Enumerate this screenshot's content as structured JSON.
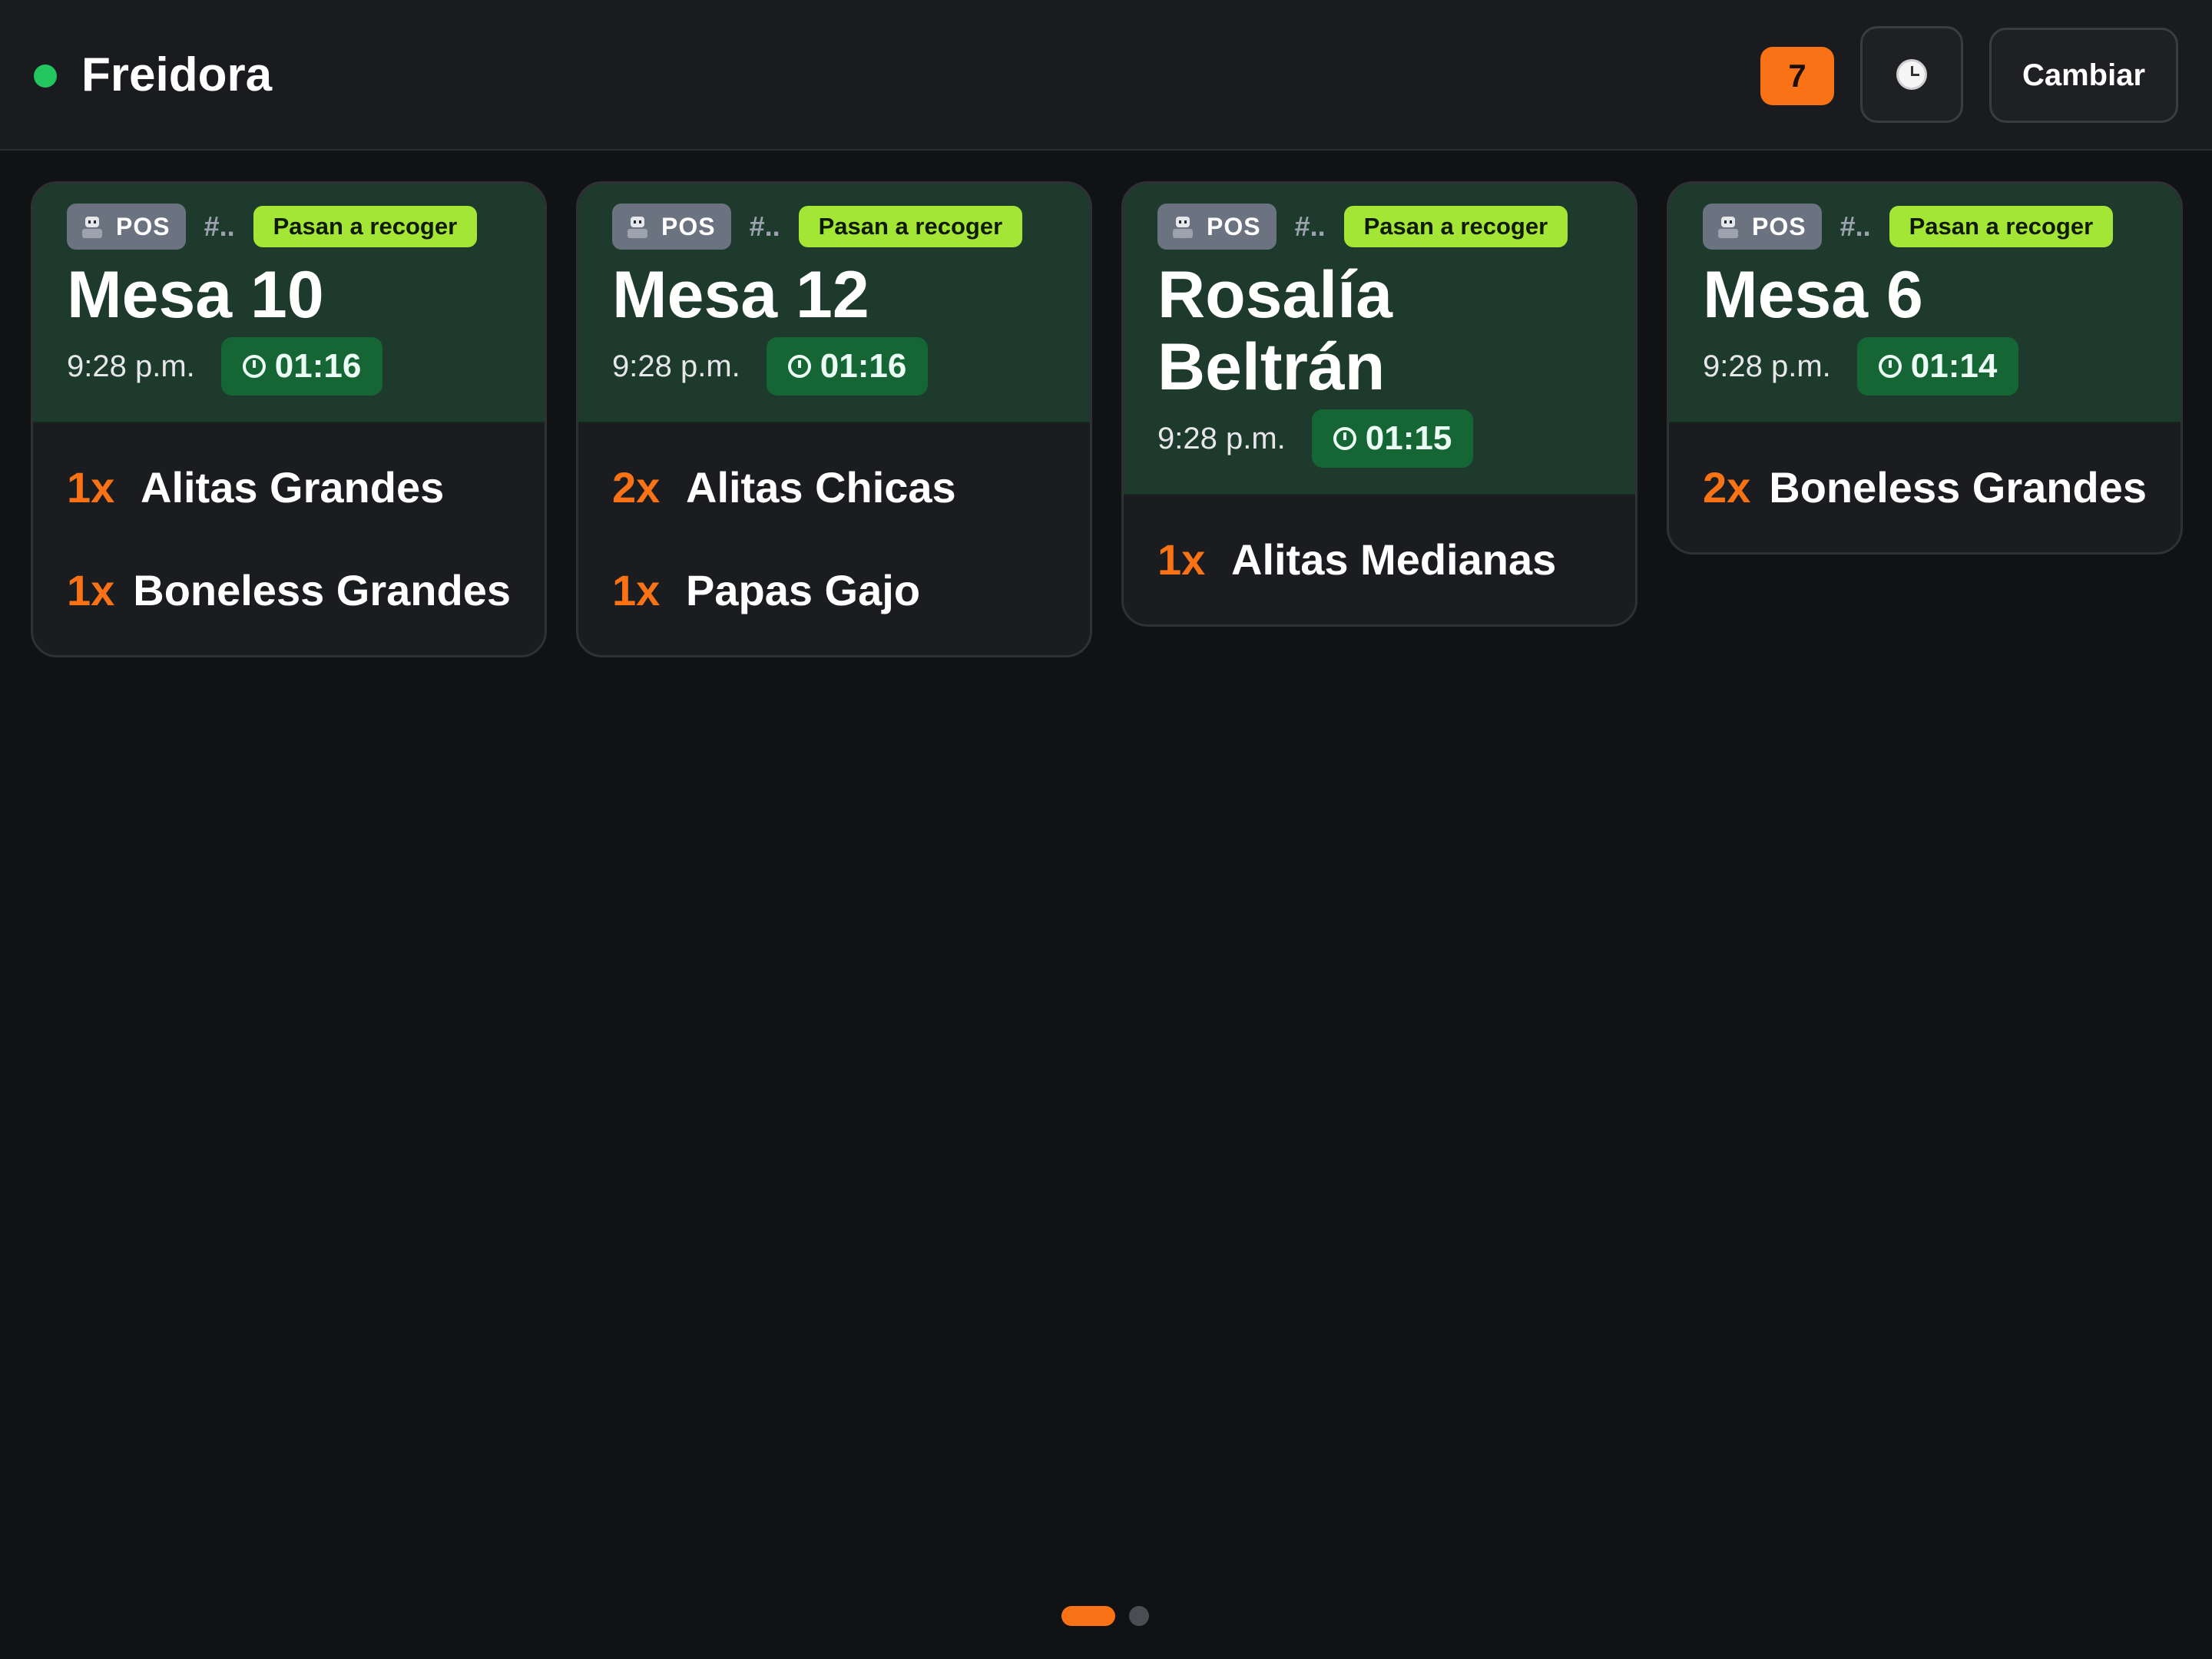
{
  "header": {
    "station_name": "Freidora",
    "status_color": "#22c55e",
    "pending_count": "7",
    "history_icon": "clock-icon",
    "change_station_label": "Cambiar"
  },
  "tickets": [
    {
      "source": "POS",
      "order_number": "#..",
      "status_tag": "Pasan a recoger",
      "title": "Mesa 10",
      "time": "9:28 p.m.",
      "elapsed": "01:16",
      "items": [
        {
          "qty": "1x",
          "name": "Alitas Grandes"
        },
        {
          "qty": "1x",
          "name": "Boneless Grandes"
        }
      ]
    },
    {
      "source": "POS",
      "order_number": "#..",
      "status_tag": "Pasan a recoger",
      "title": "Mesa 12",
      "time": "9:28 p.m.",
      "elapsed": "01:16",
      "items": [
        {
          "qty": "2x",
          "name": "Alitas Chicas"
        },
        {
          "qty": "1x",
          "name": "Papas Gajo"
        }
      ]
    },
    {
      "source": "POS",
      "order_number": "#..",
      "status_tag": "Pasan a recoger",
      "title": "Rosalía Beltrán",
      "time": "9:28 p.m.",
      "elapsed": "01:15",
      "items": [
        {
          "qty": "1x",
          "name": "Alitas Medianas"
        }
      ]
    },
    {
      "source": "POS",
      "order_number": "#..",
      "status_tag": "Pasan a recoger",
      "title": "Mesa 6",
      "time": "9:28 p.m.",
      "elapsed": "01:14",
      "items": [
        {
          "qty": "2x",
          "name": "Boneless Grandes"
        }
      ]
    }
  ],
  "pagination": {
    "pages": 2,
    "current_page": 1
  },
  "colors": {
    "accent": "#f97316",
    "ticket_header": "#1e3a2c",
    "pickup_tag": "#a3e635",
    "timer": "#166534"
  }
}
